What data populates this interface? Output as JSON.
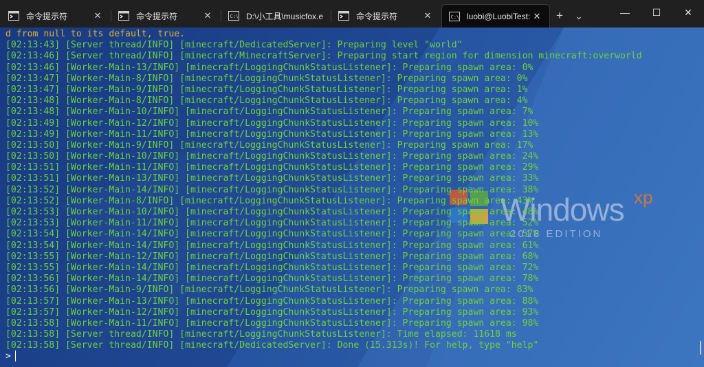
{
  "tabs": [
    {
      "label": "命令提示符",
      "icon": "cmd-icon",
      "active": false
    },
    {
      "label": "命令提示符",
      "icon": "cmd-icon",
      "active": false
    },
    {
      "label": "D:\\小工具\\musicfox.e",
      "icon": "console-icon",
      "active": false
    },
    {
      "label": "命令提示符",
      "icon": "cmd-icon",
      "active": false
    },
    {
      "label": "luobi@LuobiTest: ~/",
      "icon": "console-icon",
      "active": true
    }
  ],
  "titlebar": {
    "new_tab": "+",
    "dropdown": "⌄",
    "close": "✕",
    "minimize": "—",
    "maximize": "☐"
  },
  "colors": {
    "log_text": "#6fd23a",
    "first_line": "#e0b028",
    "background": "#2a5aa8",
    "tab_bar": "#202020"
  },
  "terminal": {
    "lines": [
      "d from null to its default, true.",
      "[02:13:43] [Server thread/INFO] [minecraft/DedicatedServer]: Preparing level \"world\"",
      "[02:13:46] [Server thread/INFO] [minecraft/MinecraftServer]: Preparing start region for dimension minecraft:overworld",
      "[02:13:46] [Worker-Main-13/INFO] [minecraft/LoggingChunkStatusListener]: Preparing spawn area: 0%",
      "[02:13:47] [Worker-Main-8/INFO] [minecraft/LoggingChunkStatusListener]: Preparing spawn area: 0%",
      "[02:13:47] [Worker-Main-9/INFO] [minecraft/LoggingChunkStatusListener]: Preparing spawn area: 1%",
      "[02:13:48] [Worker-Main-8/INFO] [minecraft/LoggingChunkStatusListener]: Preparing spawn area: 4%",
      "[02:13:48] [Worker-Main-10/INFO] [minecraft/LoggingChunkStatusListener]: Preparing spawn area: 7%",
      "[02:13:49] [Worker-Main-12/INFO] [minecraft/LoggingChunkStatusListener]: Preparing spawn area: 10%",
      "[02:13:49] [Worker-Main-11/INFO] [minecraft/LoggingChunkStatusListener]: Preparing spawn area: 13%",
      "[02:13:50] [Worker-Main-9/INFO] [minecraft/LoggingChunkStatusListener]: Preparing spawn area: 17%",
      "[02:13:50] [Worker-Main-10/INFO] [minecraft/LoggingChunkStatusListener]: Preparing spawn area: 24%",
      "[02:13:51] [Worker-Main-11/INFO] [minecraft/LoggingChunkStatusListener]: Preparing spawn area: 29%",
      "[02:13:51] [Worker-Main-13/INFO] [minecraft/LoggingChunkStatusListener]: Preparing spawn area: 33%",
      "[02:13:52] [Worker-Main-14/INFO] [minecraft/LoggingChunkStatusListener]: Preparing spawn area: 38%",
      "[02:13:52] [Worker-Main-8/INFO] [minecraft/LoggingChunkStatusListener]: Preparing spawn area: 43%",
      "[02:13:53] [Worker-Main-10/INFO] [minecraft/LoggingChunkStatusListener]: Preparing spawn area: 48%",
      "[02:13:53] [Worker-Main-11/INFO] [minecraft/LoggingChunkStatusListener]: Preparing spawn area: 52%",
      "[02:13:54] [Worker-Main-14/INFO] [minecraft/LoggingChunkStatusListener]: Preparing spawn area: 57%",
      "[02:13:54] [Worker-Main-14/INFO] [minecraft/LoggingChunkStatusListener]: Preparing spawn area: 61%",
      "[02:13:55] [Worker-Main-12/INFO] [minecraft/LoggingChunkStatusListener]: Preparing spawn area: 68%",
      "[02:13:55] [Worker-Main-14/INFO] [minecraft/LoggingChunkStatusListener]: Preparing spawn area: 72%",
      "[02:13:56] [Worker-Main-14/INFO] [minecraft/LoggingChunkStatusListener]: Preparing spawn area: 78%",
      "[02:13:56] [Worker-Main-9/INFO] [minecraft/LoggingChunkStatusListener]: Preparing spawn area: 83%",
      "[02:13:57] [Worker-Main-13/INFO] [minecraft/LoggingChunkStatusListener]: Preparing spawn area: 88%",
      "[02:13:57] [Worker-Main-12/INFO] [minecraft/LoggingChunkStatusListener]: Preparing spawn area: 93%",
      "[02:13:58] [Worker-Main-11/INFO] [minecraft/LoggingChunkStatusListener]: Preparing spawn area: 98%",
      "[02:13:58] [Server thread/INFO] [minecraft/LoggingChunkStatusListener]: Time elapsed: 11618 ms",
      "[02:13:58] [Server thread/INFO] [minecraft/DedicatedServer]: Done (15.313s)! For help, type \"help\""
    ],
    "prompt": ">"
  },
  "wallpaper": {
    "brand": "Windows",
    "superscript": "xp",
    "edition": "2018 EDITION"
  }
}
